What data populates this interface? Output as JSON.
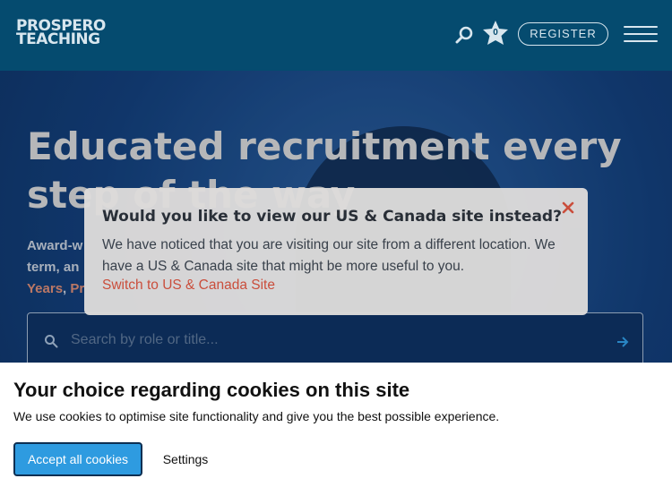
{
  "header": {
    "logo_line1": "PROSPERO",
    "logo_line2": "TEACHING",
    "favourites_count": "0",
    "register_label": "REGISTER"
  },
  "hero": {
    "title": "Educated recruitment every step of the way",
    "subtitle_start": "Award-w",
    "subtitle_line2": "term, an",
    "link_years": "Years",
    "link_pr": "Pr",
    "search_placeholder": "Search by role or title..."
  },
  "location_modal": {
    "title": "Would you like to view our US & Canada site instead?",
    "text": "We have noticed that you are visiting our site from a different location. We have a US & Canada site that might be more useful to you.",
    "link": "Switch to US & Canada Site"
  },
  "cookie_banner": {
    "title": "Your choice regarding cookies on this site",
    "text": "We use cookies to optimise site functionality and give you the best possible experience.",
    "accept_label": "Accept all cookies",
    "settings_label": "Settings"
  },
  "colors": {
    "header_bg": "#054b6f",
    "accent_link": "#d24f3a",
    "accept_button": "#2e9be0"
  },
  "icons": [
    "search-icon",
    "star-icon",
    "hamburger-menu-icon",
    "close-icon",
    "arrow-right-icon"
  ]
}
